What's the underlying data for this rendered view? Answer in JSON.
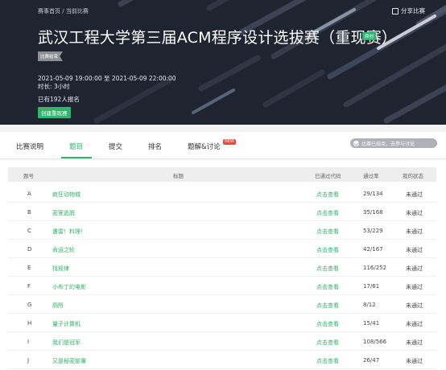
{
  "breadcrumb": {
    "home": "赛事首页",
    "sep": "/",
    "current": "当前比赛"
  },
  "share": {
    "label": "分享比赛",
    "icon": "share-icon"
  },
  "contest": {
    "title": "武汉工程大学第三届ACM程序设计选拔赛（重现赛）",
    "tag_open": "原创",
    "tag_status": "比赛结束",
    "time_range": "2021-05-09 19:00:00 至 2021-05-09 22:00:00",
    "duration": "时长: 3小时",
    "registered": "已有192人报名",
    "create_rerun": "创建重现赛"
  },
  "tabs": [
    {
      "label": "比赛说明"
    },
    {
      "label": "题目"
    },
    {
      "label": "提交"
    },
    {
      "label": "排名"
    },
    {
      "label": "题解&讨论"
    }
  ],
  "new_badge": "NEW",
  "contest_status": "比赛已结束，去参与讨论",
  "table": {
    "headers": [
      "题号",
      "标题",
      "已通过代码",
      "通过率",
      "我的状态"
    ],
    "rows": [
      {
        "id": "A",
        "title": "疯狂动物城",
        "view": "点击查看",
        "rate": "29/134",
        "state": "未通过"
      },
      {
        "id": "B",
        "title": "密室逃脱",
        "view": "点击查看",
        "rate": "35/168",
        "state": "未通过"
      },
      {
        "id": "C",
        "title": "遭雷！料理！",
        "view": "点击查看",
        "rate": "53/229",
        "state": "未通过"
      },
      {
        "id": "D",
        "title": "命运之轮",
        "view": "点击查看",
        "rate": "42/167",
        "state": "未通过"
      },
      {
        "id": "E",
        "title": "找规律",
        "view": "点击查看",
        "rate": "116/252",
        "state": "未通过"
      },
      {
        "id": "F",
        "title": "小布丁的电影",
        "view": "点击查看",
        "rate": "17/61",
        "state": "未通过"
      },
      {
        "id": "G",
        "title": "厕所",
        "view": "点击查看",
        "rate": "8/12",
        "state": "未通过"
      },
      {
        "id": "H",
        "title": "量子计算机",
        "view": "点击查看",
        "rate": "15/41",
        "state": "未通过"
      },
      {
        "id": "I",
        "title": "我们是冠军",
        "view": "点击查看",
        "rate": "108/566",
        "state": "未通过"
      },
      {
        "id": "J",
        "title": "又是秘密部署",
        "view": "点击查看",
        "rate": "26/47",
        "state": "未通过"
      }
    ]
  },
  "colors": {
    "accent": "#32b26a",
    "banner": "#1f2530",
    "badge_new": "#f2453d"
  }
}
